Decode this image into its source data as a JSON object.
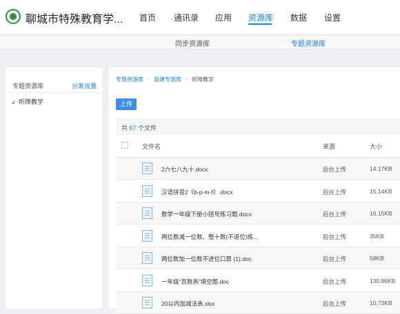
{
  "header": {
    "school_name": "聊城市特殊教育学...",
    "nav": [
      "首页",
      "通讯录",
      "应用",
      "资源库",
      "数据",
      "设置"
    ],
    "active_nav": "资源库"
  },
  "subnav": {
    "tabs": [
      "同步资源库",
      "专题资源库"
    ],
    "active_tab": "专题资源库"
  },
  "sidebar": {
    "heading": "专题资源库",
    "action": "分发设置",
    "items": [
      "听障教学"
    ]
  },
  "breadcrumb": [
    "专题资源库",
    "自建专题库",
    "听障教学"
  ],
  "toolbar": {
    "upload_label": "上传"
  },
  "file_count": {
    "prefix": "共",
    "count": "67",
    "suffix": "个文件"
  },
  "table": {
    "columns": [
      "文件名",
      "来源",
      "大小"
    ],
    "rows": [
      {
        "name": "2六七八九十.docx",
        "source": "后台上传",
        "size": "14.17KB",
        "type": "doc"
      },
      {
        "name": "汉语拼音2《b-p-m-f》.docx",
        "source": "后台上传",
        "size": "15.14KB",
        "type": "doc"
      },
      {
        "name": "数学一年级下册小括号练习题.docx",
        "source": "后台上传",
        "size": "16.15KB",
        "type": "doc"
      },
      {
        "name": "两位数减一位数、整十数(不退位)练...",
        "source": "后台上传",
        "size": "35KB",
        "type": "doc"
      },
      {
        "name": "两位数加一位数不进位口算 (1).doc",
        "source": "后台上传",
        "size": "58KB",
        "type": "doc"
      },
      {
        "name": "一年级“百数表”填空题.doc",
        "source": "后台上传",
        "size": "130.86KB",
        "type": "doc"
      },
      {
        "name": "20以内加减法表.xlsx",
        "source": "后台上传",
        "size": "10.73KB",
        "type": "xls"
      }
    ]
  },
  "colors": {
    "accent": "#1a7fd9",
    "button": "#3d8fe3",
    "brand": "#3a8a4a"
  }
}
